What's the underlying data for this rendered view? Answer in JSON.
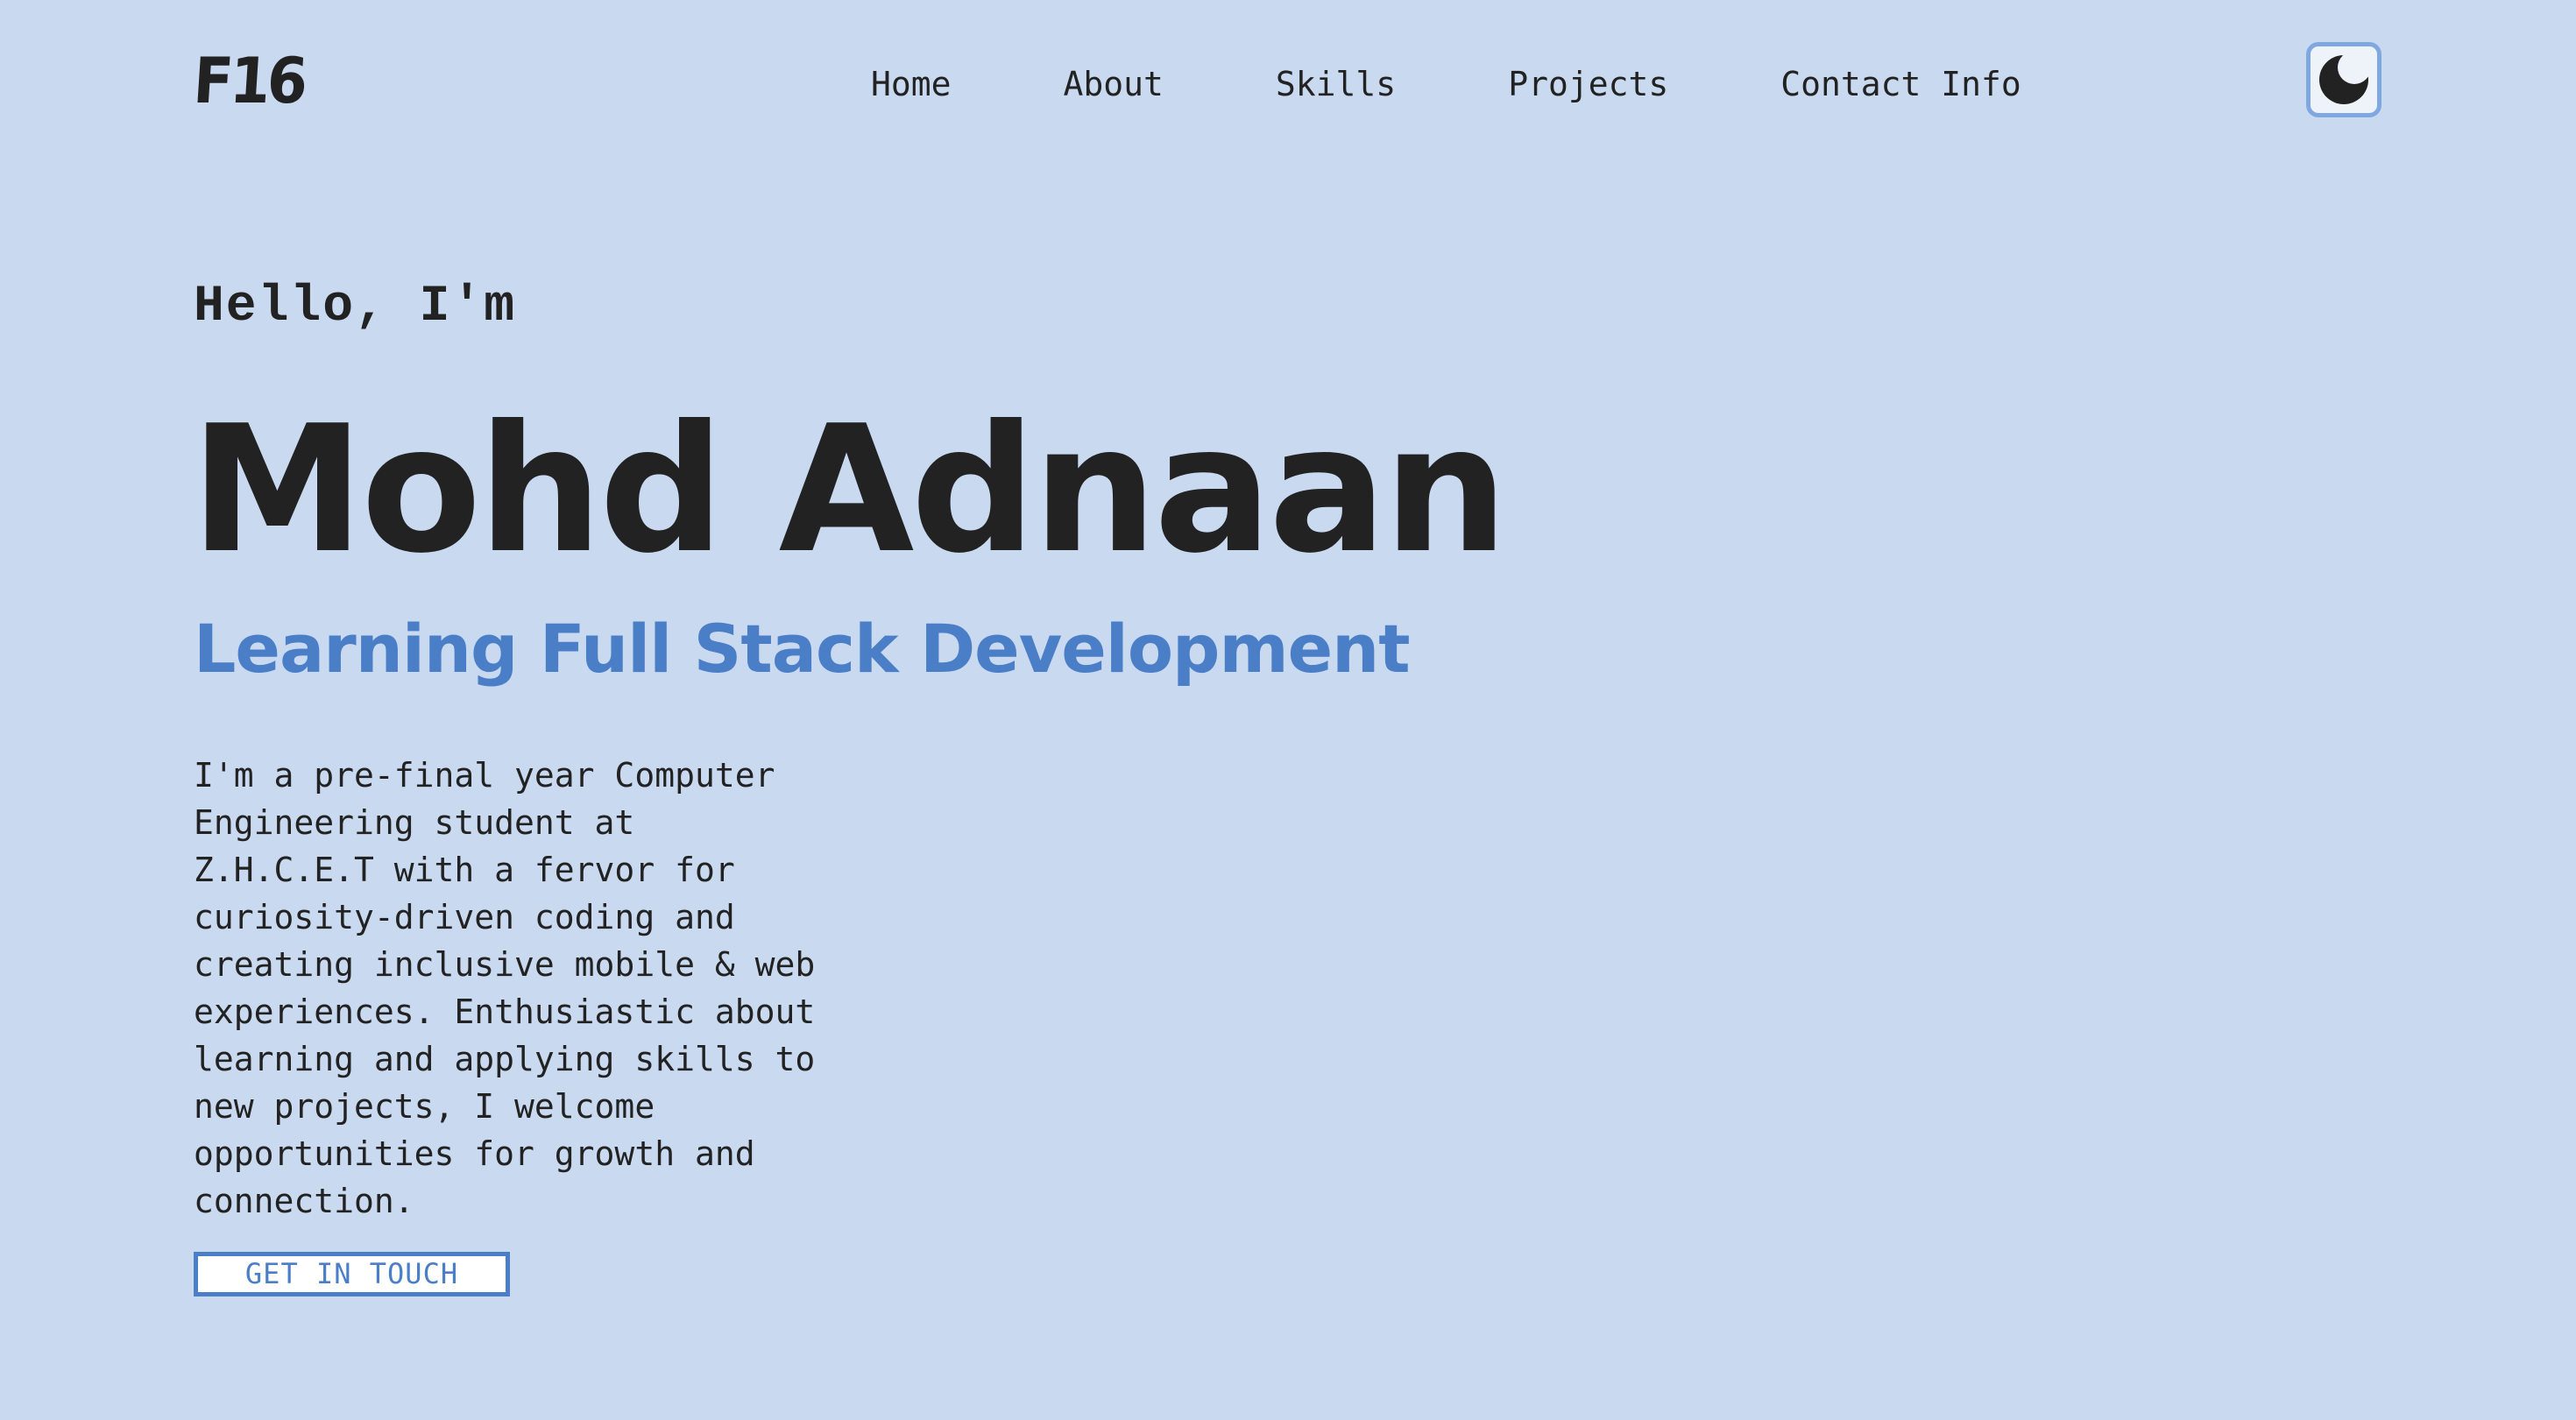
{
  "header": {
    "logo": "F16",
    "nav": [
      {
        "label": "Home"
      },
      {
        "label": "About"
      },
      {
        "label": "Skills"
      },
      {
        "label": "Projects"
      },
      {
        "label": "Contact Info"
      }
    ],
    "theme_toggle_icon": "moon-icon"
  },
  "hero": {
    "greeting": "Hello, I'm",
    "name": "Mohd Adnaan",
    "tagline": "Learning Full Stack Development",
    "bio": "I'm a pre-final year Computer Engineering student at Z.H.C.E.T with a fervor for curiosity-driven coding and creating inclusive mobile & web experiences. Enthusiastic about learning and applying skills to new projects, I welcome opportunities for growth and connection.",
    "cta_label": "GET IN TOUCH"
  },
  "colors": {
    "background": "#c9d9f0",
    "text": "#222222",
    "accent": "#4a7ec7",
    "toggle_border": "#7fa7e0"
  }
}
